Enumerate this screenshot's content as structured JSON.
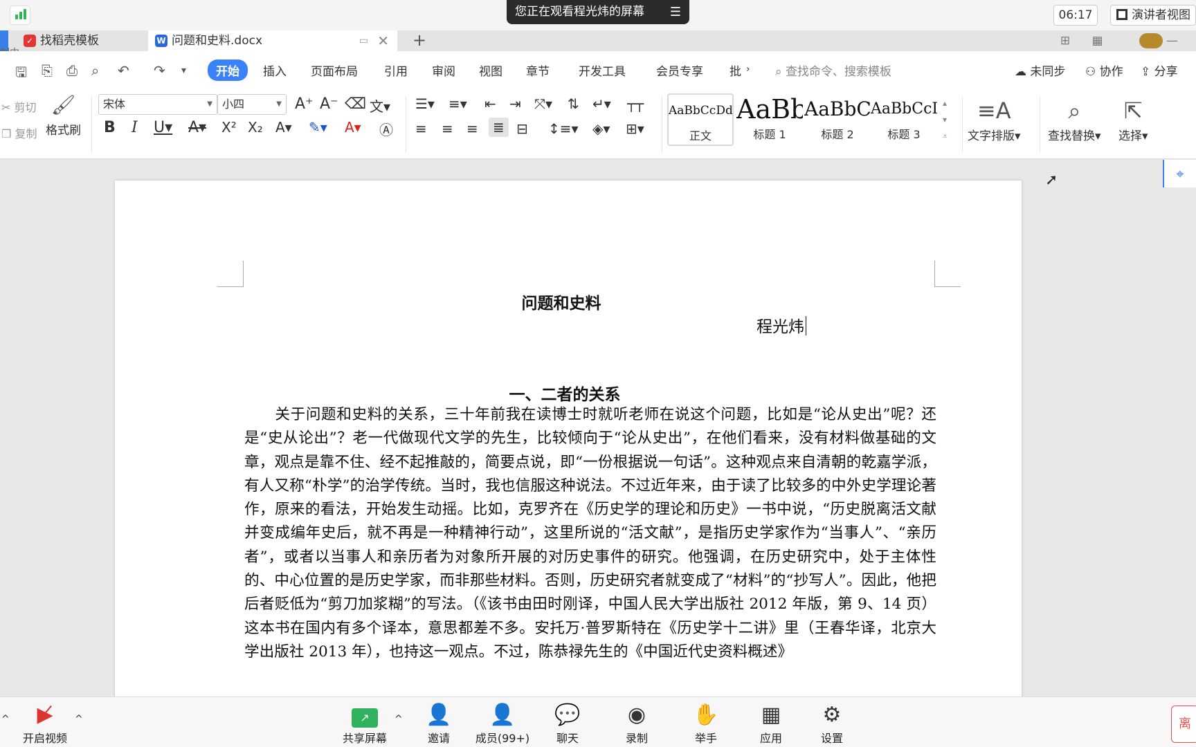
{
  "meeting": {
    "viewing_banner": "您正在观看程光炜的屏幕",
    "menu_icon": "list-icon",
    "clock": "06:17",
    "speaker_view": "演讲者视图",
    "bottom": {
      "video": "开启视频",
      "share": "共享屏幕",
      "invite": "邀请",
      "members": "成员(99+)",
      "chat": "聊天",
      "record": "录制",
      "raise_hand": "举手",
      "apps": "应用",
      "settings": "设置",
      "leave": "离"
    },
    "recording_hint": "制中"
  },
  "tabs": [
    {
      "label": "找稻壳模板",
      "icon": "docer-icon"
    },
    {
      "label": "问题和史料.docx",
      "icon": "word-doc-icon"
    }
  ],
  "menu": {
    "items": [
      "开始",
      "插入",
      "页面布局",
      "引用",
      "审阅",
      "视图",
      "章节",
      "开发工具",
      "会员专享",
      "批"
    ],
    "active": "开始",
    "search_placeholder": "查找命令、搜索模板",
    "sync": "未同步",
    "collab": "协作",
    "share": "分享"
  },
  "ribbon": {
    "cut": "剪切",
    "copy": "复制",
    "format_painter": "格式刷",
    "font_name": "宋体",
    "font_size": "小四",
    "styles": [
      {
        "sample": "AaBbCcDd",
        "name": "正文"
      },
      {
        "sample": "AaBb",
        "name": "标题 1"
      },
      {
        "sample": "AaBbC",
        "name": "标题 2"
      },
      {
        "sample": "AaBbCcI",
        "name": "标题 3"
      }
    ],
    "text_layout": "文字排版",
    "find_replace": "查找替换",
    "select": "选择"
  },
  "document": {
    "title": "问题和史料",
    "author": "程光炜",
    "section_heading": "一、二者的关系",
    "body": "　　关于问题和史料的关系，三十年前我在读博士时就听老师在说这个问题，比如是“论从史出”呢？还是“史从论出”？老一代做现代文学的先生，比较倾向于“论从史出”，在他们看来，没有材料做基础的文章，观点是靠不住、经不起推敲的，简要点说，即“一份根据说一句话”。这种观点来自清朝的乾嘉学派，有人又称“朴学”的治学传统。当时，我也信服这种说法。不过近年来，由于读了比较多的中外史学理论著作，原来的看法，开始发生动摇。比如，克罗齐在《历史学的理论和历史》一书中说，“历史脱离活文献并变成编年史后，就不再是一种精神行动”，这里所说的“活文献”，是指历史学家作为“当事人”、“亲历者”，或者以当事人和亲历者为对象所开展的对历史事件的研究。他强调，在历史研究中，处于主体性的、中心位置的是历史学家，而非那些材料。否则，历史研究者就变成了“材料”的“抄写人”。因此，他把后者贬低为“剪刀加浆糊”的写法。（《该书由田时刚译，中国人民大学出版社 2012 年版，第 9、14 页）这本书在国内有多个译本，意思都差不多。安托万·普罗斯特在《历史学十二讲》里（王春华译，北京大学出版社 2013 年），也持这一观点。不过，陈恭禄先生的《中国近代史资料概述》"
  }
}
